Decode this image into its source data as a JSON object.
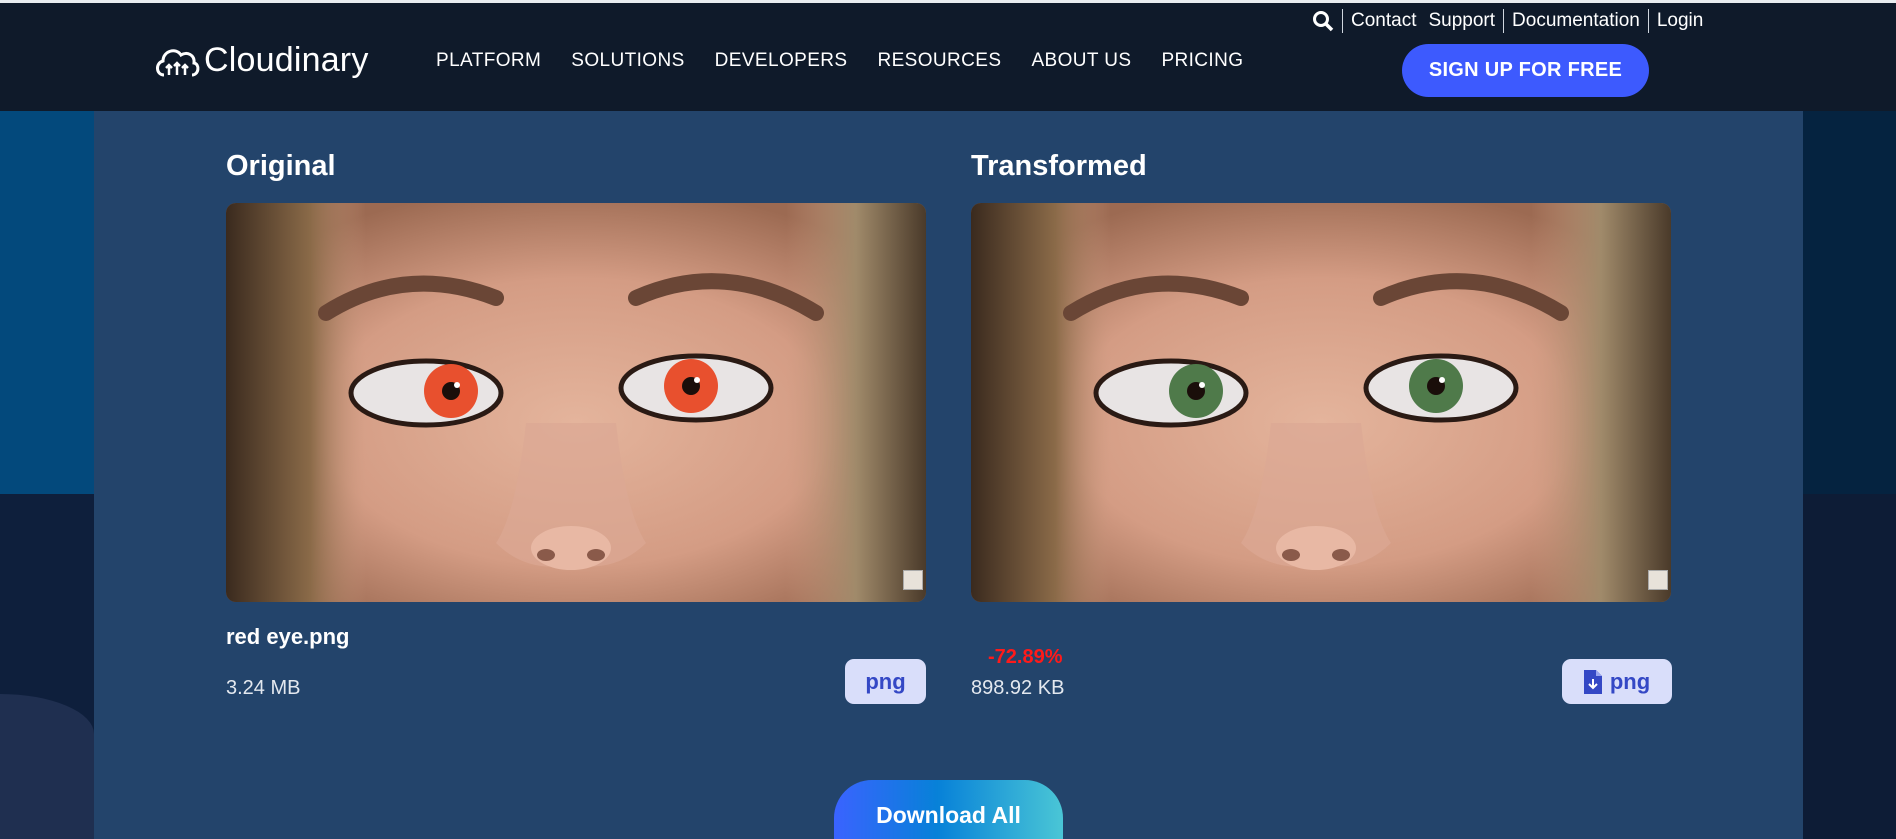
{
  "header": {
    "logo_text": "Cloudinary",
    "menu": [
      "PLATFORM",
      "SOLUTIONS",
      "DEVELOPERS",
      "RESOURCES",
      "ABOUT US",
      "PRICING"
    ],
    "top_links": [
      "Contact",
      "Support",
      "Documentation",
      "Login"
    ],
    "signup_label": "SIGN UP FOR FREE"
  },
  "original": {
    "heading": "Original",
    "file_name": "red eye.png",
    "size": "3.24 MB",
    "format": "png",
    "eye_color": "#e8502e"
  },
  "transformed": {
    "heading": "Transformed",
    "change": "-72.89%",
    "size": "898.92 KB",
    "format": "png",
    "eye_color": "#4f7a4a"
  },
  "download_all_label": "Download All",
  "colors": {
    "accent": "#3d5afe",
    "panel": "#23446b",
    "nav": "#0f1a2a",
    "negative": "#ff1a1a"
  }
}
